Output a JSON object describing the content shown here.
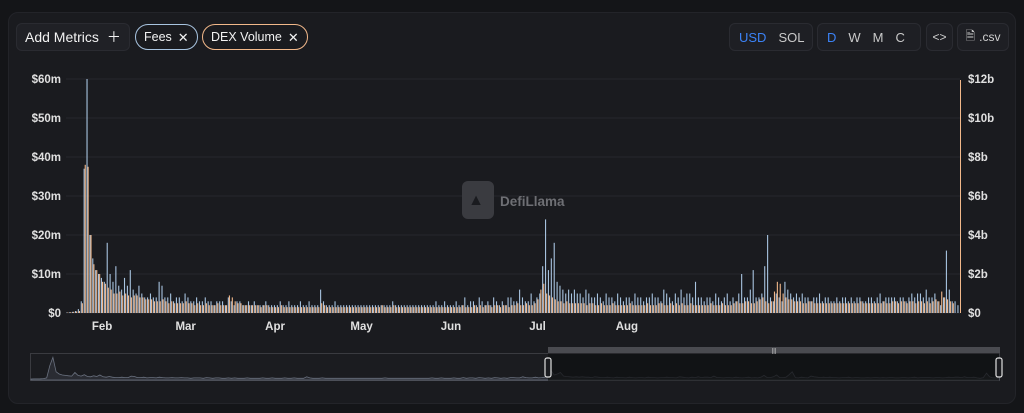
{
  "toolbar": {
    "add_metrics_label": "Add Metrics",
    "chips": [
      {
        "label": "Fees",
        "color": "#a8c4e0"
      },
      {
        "label": "DEX Volume",
        "color": "#f2b88a"
      }
    ],
    "currency_options": [
      "USD",
      "SOL"
    ],
    "currency_selected": "USD",
    "period_options": [
      "D",
      "W",
      "M",
      "C"
    ],
    "period_selected": "D",
    "embed_icon": "code-icon",
    "csv_label": ".csv"
  },
  "watermark": "DefiLlama",
  "colors": {
    "fees": "#a8c4e0",
    "dex_volume": "#f2b88a",
    "accent": "#3b82f6",
    "background": "#1a1b1f"
  },
  "chart_data": {
    "type": "bar",
    "title": "",
    "xlabel": "",
    "ylabel": "",
    "x_ticks": [
      "Feb",
      "Mar",
      "Apr",
      "May",
      "Jun",
      "Jul",
      "Aug"
    ],
    "y_left_ticks": [
      "$0",
      "$10m",
      "$20m",
      "$30m",
      "$40m",
      "$50m",
      "$60m"
    ],
    "y_right_ticks": [
      "$0",
      "$2b",
      "$4b",
      "$6b",
      "$8b",
      "$10b",
      "$12b"
    ],
    "y_left_lim": [
      0,
      60
    ],
    "y_right_lim": [
      0,
      12
    ],
    "y_left_unit": "m",
    "y_right_unit": "b",
    "grid": true,
    "legend": "top-left chips",
    "x_start": "2024-01-20",
    "series": [
      {
        "name": "Fees",
        "axis": "left",
        "values": [
          0.1,
          0.2,
          0.3,
          0.5,
          1,
          3,
          37,
          60,
          20,
          14,
          11,
          10,
          9,
          8,
          18,
          10,
          8,
          12,
          7,
          6,
          9,
          7,
          11,
          6,
          5,
          7,
          5,
          4,
          4,
          5,
          4,
          4,
          8,
          7,
          4,
          4,
          5,
          3,
          4,
          4,
          3,
          5,
          4,
          3,
          3,
          4,
          3,
          3,
          4,
          3,
          3,
          2,
          3,
          3,
          3,
          2,
          4,
          3,
          2,
          3,
          3,
          2,
          2,
          3,
          2,
          3,
          2,
          2,
          2,
          3,
          2,
          2,
          2,
          2,
          3,
          2,
          2,
          3,
          2,
          2,
          2,
          3,
          2,
          2,
          3,
          2,
          2,
          2,
          6,
          3,
          2,
          2,
          2,
          3,
          2,
          2,
          2,
          2,
          2,
          2,
          2,
          2,
          2,
          2,
          2,
          2,
          2,
          2,
          2,
          2,
          2,
          2,
          2,
          3,
          2,
          2,
          2,
          2,
          2,
          2,
          2,
          2,
          2,
          2,
          2,
          2,
          2,
          2,
          3,
          2,
          2,
          3,
          2,
          2,
          2,
          3,
          2,
          2,
          4,
          2,
          3,
          3,
          2,
          4,
          3,
          2,
          3,
          2,
          4,
          3,
          2,
          3,
          2,
          4,
          4,
          3,
          3,
          6,
          4,
          3,
          3,
          5,
          3,
          4,
          5,
          12,
          24,
          11,
          14,
          18,
          8,
          7,
          6,
          5,
          6,
          5,
          6,
          5,
          5,
          4,
          6,
          5,
          4,
          4,
          5,
          4,
          3,
          5,
          4,
          4,
          3,
          5,
          4,
          3,
          4,
          4,
          3,
          5,
          4,
          4,
          3,
          4,
          4,
          5,
          4,
          4,
          3,
          6,
          5,
          4,
          3,
          5,
          4,
          6,
          4,
          5,
          5,
          4,
          8,
          4,
          4,
          3,
          4,
          4,
          3,
          5,
          4,
          3,
          4,
          5,
          3,
          4,
          3,
          5,
          10,
          4,
          4,
          6,
          11,
          4,
          4,
          5,
          12,
          20,
          4,
          3,
          5,
          4,
          3,
          8,
          6,
          5,
          4,
          5,
          4,
          5,
          4,
          4,
          3,
          4,
          4,
          5,
          3,
          4,
          4,
          3,
          3,
          4,
          3,
          4,
          4,
          3,
          4,
          3,
          4,
          4,
          3,
          3,
          4,
          4,
          3,
          4,
          5,
          3,
          4,
          4,
          4,
          4,
          3,
          4,
          4,
          3,
          4,
          5,
          4,
          5,
          5,
          4,
          6,
          4,
          4,
          5,
          3,
          2,
          4,
          16,
          6,
          3,
          3,
          2
        ]
      },
      {
        "name": "DEX Volume",
        "axis": "right",
        "values": [
          0.02,
          0.04,
          0.06,
          0.08,
          0.1,
          0.5,
          7.6,
          7.5,
          4,
          2.5,
          2.2,
          2,
          1.6,
          1.5,
          1.3,
          1.2,
          1,
          1,
          1.1,
          0.9,
          1,
          0.9,
          0.8,
          0.9,
          0.9,
          0.8,
          0.8,
          0.7,
          0.7,
          0.7,
          0.6,
          0.6,
          0.6,
          0.7,
          0.6,
          0.5,
          0.6,
          0.5,
          0.5,
          0.5,
          0.5,
          0.6,
          0.5,
          0.5,
          0.4,
          0.5,
          0.4,
          0.4,
          0.5,
          0.4,
          0.4,
          0.4,
          0.5,
          0.4,
          0.4,
          0.4,
          0.9,
          0.8,
          0.6,
          0.5,
          0.5,
          0.4,
          0.4,
          0.4,
          0.4,
          0.4,
          0.4,
          0.3,
          0.4,
          0.4,
          0.3,
          0.3,
          0.3,
          0.3,
          0.4,
          0.3,
          0.3,
          0.3,
          0.3,
          0.3,
          0.3,
          0.3,
          0.3,
          0.3,
          0.3,
          0.3,
          0.3,
          0.3,
          0.5,
          0.4,
          0.3,
          0.3,
          0.3,
          0.3,
          0.3,
          0.3,
          0.3,
          0.3,
          0.3,
          0.3,
          0.3,
          0.3,
          0.3,
          0.3,
          0.3,
          0.3,
          0.3,
          0.3,
          0.3,
          0.4,
          0.3,
          0.3,
          0.3,
          0.4,
          0.3,
          0.3,
          0.3,
          0.3,
          0.3,
          0.3,
          0.3,
          0.3,
          0.3,
          0.3,
          0.3,
          0.3,
          0.3,
          0.3,
          0.3,
          0.3,
          0.3,
          0.3,
          0.3,
          0.3,
          0.3,
          0.3,
          0.3,
          0.4,
          0.3,
          0.3,
          0.3,
          0.4,
          0.3,
          0.4,
          0.3,
          0.4,
          0.4,
          0.3,
          0.4,
          0.4,
          0.3,
          0.4,
          0.4,
          0.3,
          0.4,
          0.4,
          0.5,
          0.4,
          0.4,
          0.5,
          0.4,
          0.4,
          0.5,
          0.7,
          1.2,
          1.5,
          1,
          0.9,
          0.8,
          0.7,
          0.6,
          0.6,
          0.5,
          0.6,
          0.5,
          0.5,
          0.5,
          0.5,
          0.5,
          0.5,
          0.4,
          0.5,
          0.5,
          0.4,
          0.4,
          0.5,
          0.4,
          0.4,
          0.4,
          0.5,
          0.4,
          0.4,
          0.4,
          0.4,
          0.4,
          0.5,
          0.4,
          0.4,
          0.4,
          0.4,
          0.4,
          0.5,
          0.4,
          0.4,
          0.4,
          0.5,
          0.5,
          0.4,
          0.4,
          0.5,
          0.4,
          0.5,
          0.4,
          0.5,
          0.4,
          0.4,
          0.5,
          0.4,
          0.4,
          0.4,
          0.4,
          0.4,
          0.4,
          0.5,
          0.4,
          0.4,
          0.4,
          0.5,
          0.4,
          0.4,
          0.4,
          0.5,
          0.6,
          0.5,
          0.5,
          0.6,
          0.6,
          0.5,
          0.5,
          0.6,
          0.7,
          0.8,
          0.6,
          0.5,
          0.6,
          1.1,
          1.6,
          1.5,
          1,
          0.8,
          0.7,
          0.7,
          0.6,
          0.6,
          0.6,
          0.5,
          0.5,
          0.6,
          0.6,
          0.5,
          0.5,
          0.5,
          0.5,
          0.5,
          0.5,
          0.5,
          0.5,
          0.5,
          0.5,
          0.5,
          0.5,
          0.5,
          0.5,
          0.5,
          0.5,
          0.6,
          0.5,
          0.5,
          0.5,
          0.5,
          0.5,
          0.5,
          0.5,
          0.6,
          0.5,
          0.5,
          0.6,
          0.6,
          0.5,
          0.6,
          0.6,
          0.5,
          0.6,
          0.6,
          0.5,
          0.6,
          0.6,
          0.5,
          0.6,
          0.5,
          0.6,
          0.7,
          0.6,
          1.1,
          0.8,
          0.7,
          0.6,
          0.5
        ]
      }
    ]
  }
}
